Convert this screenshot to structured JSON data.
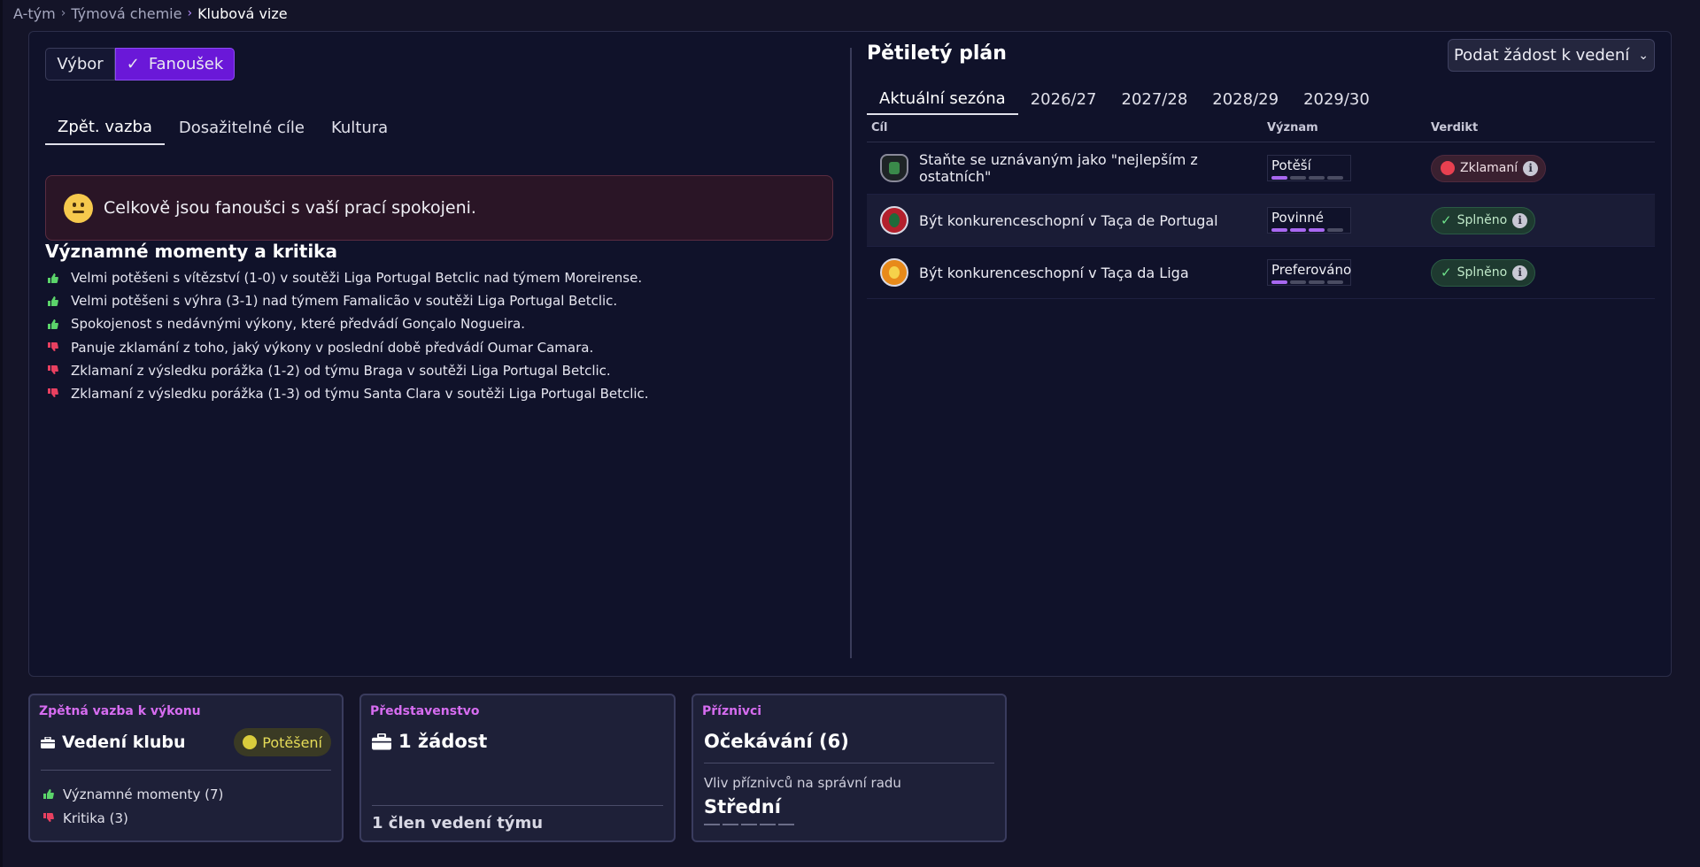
{
  "breadcrumb": {
    "items": [
      "A-tým",
      "Týmová chemie",
      "Klubová vize"
    ]
  },
  "toggle": {
    "option_board": "Výbor",
    "option_fans": "Fanoušek"
  },
  "left_tabs": [
    "Zpět. vazba",
    "Dosažitelné cíle",
    "Kultura"
  ],
  "mood": {
    "text": "Celkově jsou fanoušci s vaší prací spokojeni."
  },
  "moments": {
    "title": "Významné momenty a kritika",
    "items": [
      {
        "type": "positive",
        "text": "Velmi potěšeni s vítězství (1-0) v soutěži Liga Portugal Betclic nad týmem Moreirense."
      },
      {
        "type": "positive",
        "text": "Velmi potěšeni s výhra (3-1) nad týmem Famalicão v soutěži Liga Portugal Betclic."
      },
      {
        "type": "positive",
        "text": "Spokojenost s nedávnými výkony, které předvádí Gonçalo Nogueira."
      },
      {
        "type": "negative",
        "text": "Panuje zklamání z toho, jaký výkony v poslední době předvádí Oumar Camara."
      },
      {
        "type": "negative",
        "text": "Zklamaní z výsledku porážka (1-2) od týmu Braga v soutěži Liga Portugal Betclic."
      },
      {
        "type": "negative",
        "text": "Zklamaní z výsledku porážka (1-3) od týmu Santa Clara v soutěži Liga Portugal Betclic."
      }
    ]
  },
  "plan": {
    "title": "Pětiletý plán",
    "request_button": "Podat žádost k vedení",
    "season_tabs": [
      "Aktuální sezóna",
      "2026/27",
      "2027/28",
      "2028/29",
      "2029/30"
    ],
    "columns": {
      "goal": "Cíl",
      "importance": "Význam",
      "verdict": "Verdikt"
    },
    "rows": [
      {
        "goal": "Staňte se uznávaným jako \"nejlepším z ostatních\"",
        "importance": "Potěší",
        "importance_level": 1,
        "verdict": "Zklamaní",
        "verdict_status": "bad"
      },
      {
        "goal": "Být konkurenceschopní v Taça de Portugal",
        "importance": "Povinné",
        "importance_level": 3,
        "verdict": "Splněno",
        "verdict_status": "good"
      },
      {
        "goal": "Být konkurenceschopní v Taça da Liga",
        "importance": "Preferováno",
        "importance_level": 1,
        "verdict": "Splněno",
        "verdict_status": "good"
      }
    ]
  },
  "cards": {
    "performance": {
      "eyebrow": "Zpětná vazba k výkonu",
      "title": "Vedení klubu",
      "badge": "Potěšení",
      "moments_label": "Významné momenty (7)",
      "critique_label": "Kritika (3)"
    },
    "board": {
      "eyebrow": "Představenstvo",
      "title": "1 žádost",
      "footer": "1 člen vedení týmu"
    },
    "supporters": {
      "eyebrow": "Příznivci",
      "title": "Očekávání (6)",
      "influence_label": "Vliv příznivců na správní radu",
      "influence_value": "Střední",
      "influence_level": 0
    }
  },
  "colors": {
    "accent": "#6a18d8",
    "positive": "#5bd46a",
    "negative": "#e84060",
    "eyebrow": "#d66cf0"
  }
}
